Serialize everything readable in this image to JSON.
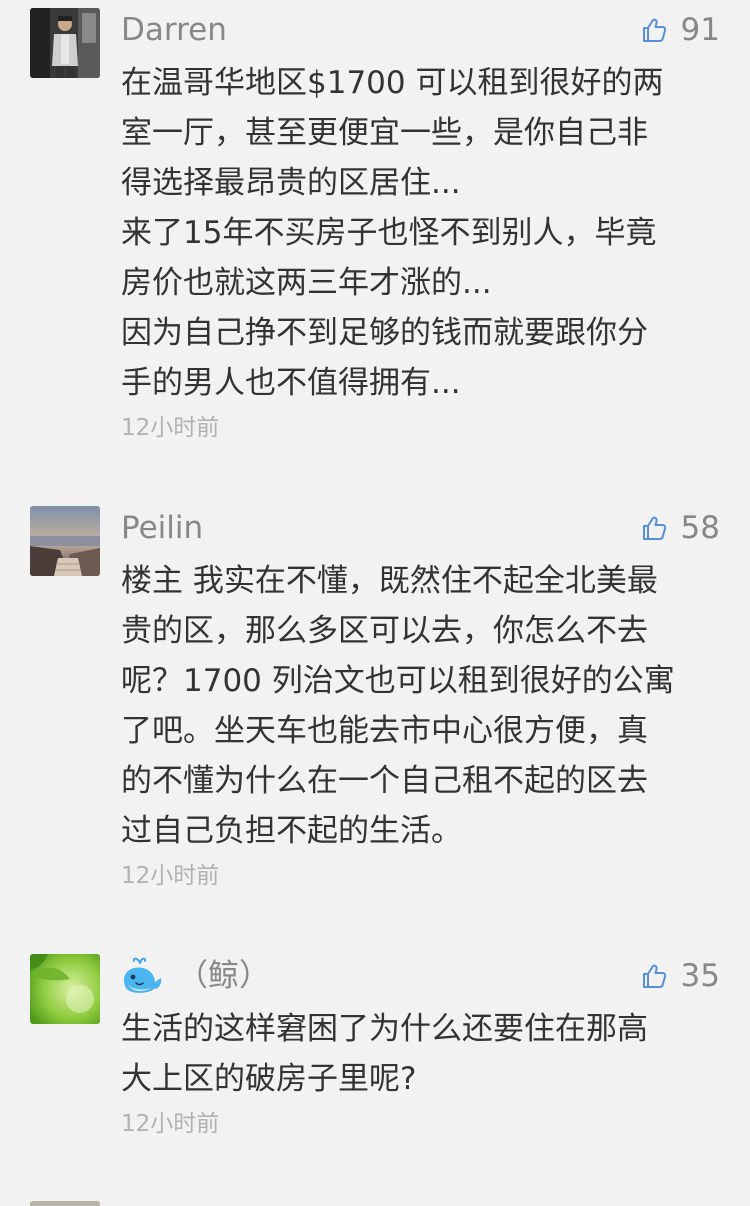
{
  "comments": [
    {
      "name": "Darren",
      "likes": "91",
      "text": "在温哥华地区$1700 可以租到很好的两\n室一厅，甚至更便宜一些，是你自己非\n得选择最昂贵的区居住...\n来了15年不买房子也怪不到别人，毕竟\n房价也就这两三年才涨的...\n因为自己挣不到足够的钱而就要跟你分\n手的男人也不值得拥有...",
      "time": "12小时前"
    },
    {
      "name": "Peilin",
      "likes": "58",
      "text": "楼主 我实在不懂，既然住不起全北美最\n贵的区，那么多区可以去，你怎么不去\n呢？1700 列治文也可以租到很好的公寓\n了吧。坐天车也能去市中心很方便，真\n的不懂为什么在一个自己租不起的区去\n过自己负担不起的生活。",
      "time": "12小时前"
    },
    {
      "name": "（鲸）",
      "likes": "35",
      "text": "生活的这样窘困了为什么还要住在那高\n大上区的破房子里呢?",
      "time": "12小时前"
    }
  ]
}
